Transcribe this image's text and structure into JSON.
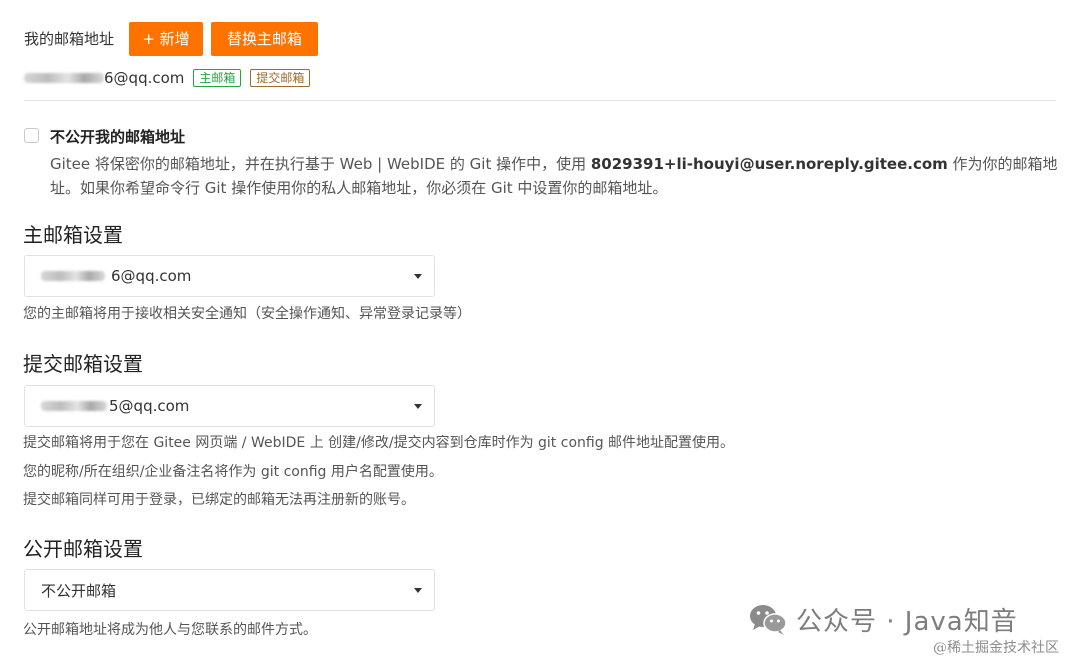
{
  "header": {
    "label": "我的邮箱地址",
    "add_button": "+ 新增",
    "replace_button": "替换主邮箱"
  },
  "email_list": {
    "email_suffix": "6@qq.com",
    "tag_primary": "主邮箱",
    "tag_commit": "提交邮箱"
  },
  "privacy": {
    "checkbox_checked": false,
    "checkbox_label": "不公开我的邮箱地址",
    "desc_prefix": "Gitee 将保密你的邮箱地址，并在执行基于 Web | WebIDE 的 Git 操作中，使用 ",
    "desc_noreply": "8029391+li-houyi@user.noreply.gitee.com",
    "desc_suffix": " 作为你的邮箱地址。如果你希望命令行 Git 操作使用你的私人邮箱地址，你必须在 Git 中设置你的邮箱地址。"
  },
  "primary_section": {
    "title": "主邮箱设置",
    "selected_suffix": "6@qq.com",
    "help": "您的主邮箱将用于接收相关安全通知（安全操作通知、异常登录记录等）"
  },
  "commit_section": {
    "title": "提交邮箱设置",
    "selected_suffix": "5@qq.com",
    "help_lines": [
      "提交邮箱将用于您在 Gitee 网页端 / WebIDE 上 创建/修改/提交内容到仓库时作为 git config 邮件地址配置使用。",
      "您的昵称/所在组织/企业备注名将作为 git config 用户名配置使用。",
      "提交邮箱同样可用于登录，已绑定的邮箱无法再注册新的账号。"
    ]
  },
  "public_section": {
    "title": "公开邮箱设置",
    "selected": "不公开邮箱",
    "help": "公开邮箱地址将成为他人与您联系的邮件方式。"
  },
  "watermarks": {
    "wechat_text": "公众号 · Java知音",
    "juejin_text": "@稀土掘金技术社区"
  },
  "colors": {
    "accent": "#fe7300",
    "tag_primary": "#21a642",
    "tag_commit": "#a06a2c"
  },
  "icons": {
    "dropdown": "chevron-down-icon",
    "wechat": "wechat-icon"
  }
}
